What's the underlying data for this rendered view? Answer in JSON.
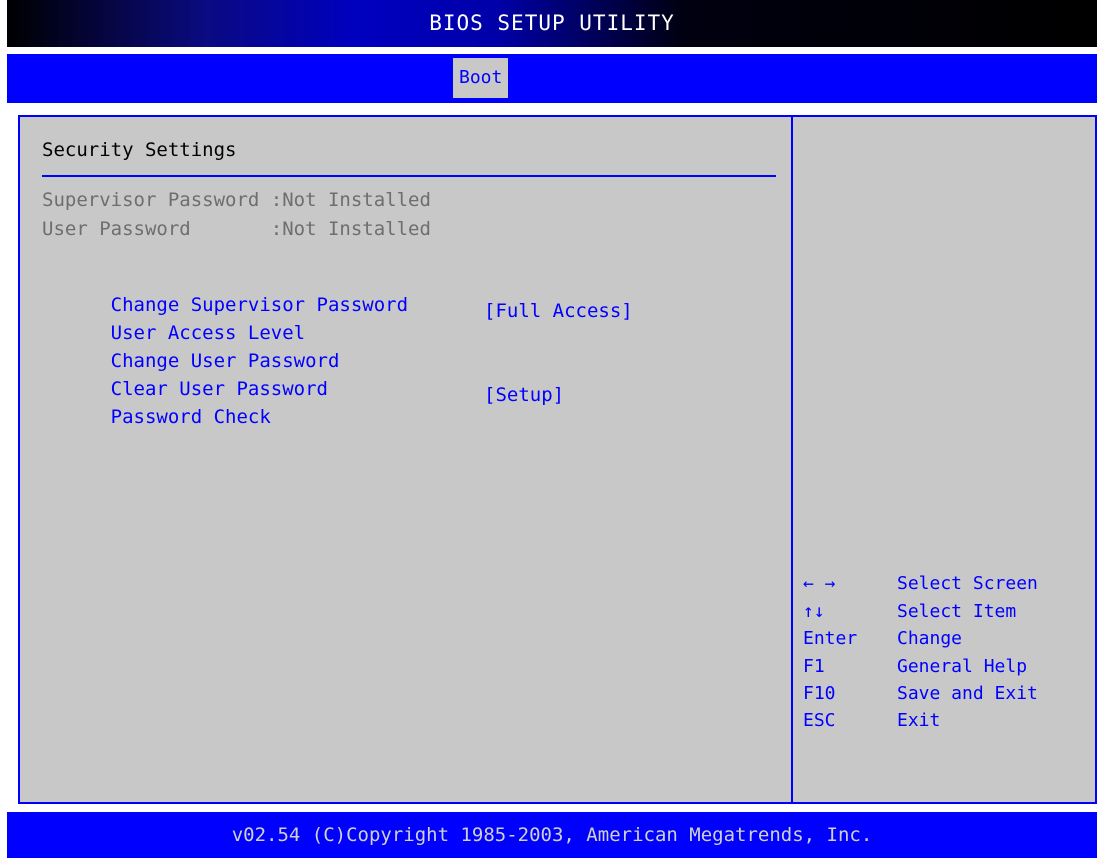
{
  "header": {
    "title": "BIOS SETUP UTILITY",
    "active_tab": "Boot"
  },
  "main": {
    "section_title": "Security Settings",
    "info": [
      {
        "label": "Supervisor Password :Not Installed"
      },
      {
        "label": "User Password       :Not Installed"
      }
    ],
    "menu": [
      {
        "label": "Change Supervisor Password",
        "value": ""
      },
      {
        "label": "User Access Level",
        "value": "[Full Access]"
      },
      {
        "label": "Change User Password",
        "value": ""
      },
      {
        "label": "Clear User Password",
        "value": ""
      },
      {
        "label": "Password Check",
        "value": "[Setup]"
      }
    ]
  },
  "help": {
    "keys": [
      {
        "key": "← →",
        "desc": "Select Screen"
      },
      {
        "key": "↑↓",
        "desc": "Select Item"
      },
      {
        "key": "Enter",
        "desc": "Change"
      },
      {
        "key": "F1",
        "desc": "General Help"
      },
      {
        "key": "F10",
        "desc": "Save and Exit"
      },
      {
        "key": "ESC",
        "desc": "Exit"
      }
    ]
  },
  "footer": {
    "copyright": "v02.54 (C)Copyright 1985-2003, American Megatrends, Inc."
  },
  "colors": {
    "blue": "#0000ff",
    "panel_gray": "#c8c8c8",
    "disabled_text": "#6e6e6e"
  }
}
